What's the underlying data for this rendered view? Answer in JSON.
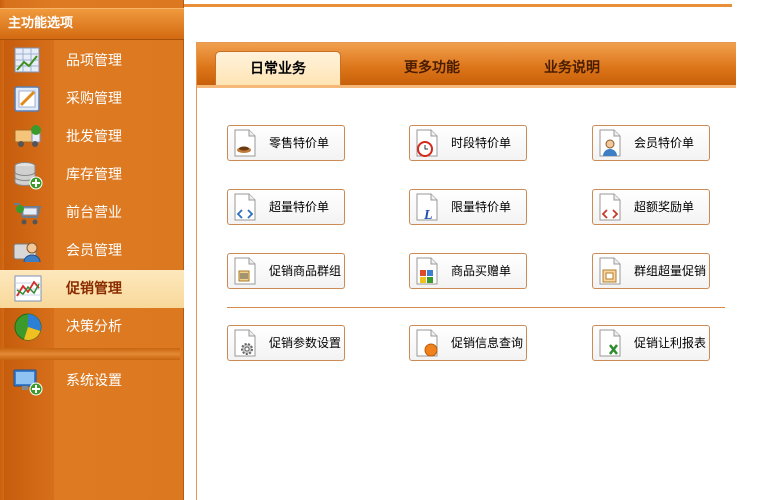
{
  "sidebar": {
    "title": "主功能选项",
    "items": [
      {
        "label": "品项管理",
        "icon": "item-grid-icon"
      },
      {
        "label": "采购管理",
        "icon": "purchase-pen-icon"
      },
      {
        "label": "批发管理",
        "icon": "wholesale-truck-icon"
      },
      {
        "label": "库存管理",
        "icon": "database-add-icon"
      },
      {
        "label": "前台营业",
        "icon": "cart-icon"
      },
      {
        "label": "会员管理",
        "icon": "member-card-icon"
      },
      {
        "label": "促销管理",
        "icon": "chart-line-icon",
        "active": true
      },
      {
        "label": "决策分析",
        "icon": "pie-chart-icon"
      },
      {
        "label": "系统设置",
        "icon": "monitor-add-icon"
      }
    ]
  },
  "tabs": [
    {
      "label": "日常业务",
      "active": true
    },
    {
      "label": "更多功能"
    },
    {
      "label": "业务说明"
    }
  ],
  "actions": [
    {
      "label": "零售特价单",
      "icon": "cup-icon"
    },
    {
      "label": "时段特价单",
      "icon": "clock-icon"
    },
    {
      "label": "会员特价单",
      "icon": "user-icon"
    },
    {
      "label": "超量特价单",
      "icon": "arrows-icon"
    },
    {
      "label": "限量特价单",
      "icon": "letter-l-icon"
    },
    {
      "label": "超额奖励单",
      "icon": "arrows-icon"
    },
    {
      "label": "促销商品群组",
      "icon": "barcode-icon"
    },
    {
      "label": "商品买赠单",
      "icon": "blocks-icon"
    },
    {
      "label": "群组超量促销",
      "icon": "frame-icon"
    },
    {
      "label": "促销参数设置",
      "icon": "gear-icon"
    },
    {
      "label": "促销信息查询",
      "icon": "orange-dot-icon"
    },
    {
      "label": "促销让利报表",
      "icon": "excel-icon"
    }
  ],
  "colors": {
    "sidebar": "#dc7820",
    "active_bg": "#fde8bd",
    "tab_bar": "#dc7418",
    "button_border": "#cc8a55"
  }
}
